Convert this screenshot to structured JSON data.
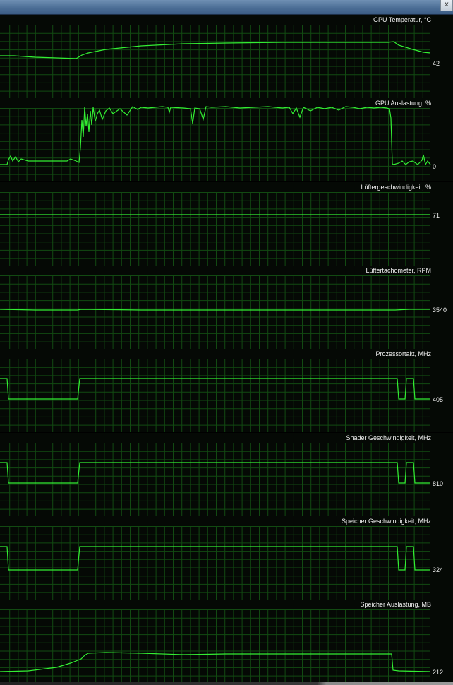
{
  "window": {
    "close_label": "x"
  },
  "colors": {
    "line": "#33ee33",
    "grid": "#124a12",
    "background": "#050905",
    "text": "#f0f0f0"
  },
  "panels": [
    {
      "title": "GPU Temperatur, °C",
      "value": "42",
      "points": [
        [
          0,
          58
        ],
        [
          20,
          58
        ],
        [
          50,
          60
        ],
        [
          80,
          61
        ],
        [
          108,
          62
        ],
        [
          116,
          57
        ],
        [
          125,
          54
        ],
        [
          150,
          49
        ],
        [
          200,
          44
        ],
        [
          260,
          41
        ],
        [
          320,
          40
        ],
        [
          400,
          39
        ],
        [
          480,
          39
        ],
        [
          550,
          39
        ],
        [
          558,
          38
        ],
        [
          565,
          43
        ],
        [
          585,
          49
        ],
        [
          600,
          53
        ],
        [
          610,
          54
        ]
      ]
    },
    {
      "title": "GPU Auslastung, %",
      "value": "0",
      "points": [
        [
          0,
          94
        ],
        [
          10,
          94
        ],
        [
          12,
          87
        ],
        [
          15,
          82
        ],
        [
          18,
          89
        ],
        [
          22,
          83
        ],
        [
          26,
          90
        ],
        [
          30,
          86
        ],
        [
          40,
          89
        ],
        [
          60,
          89
        ],
        [
          80,
          89
        ],
        [
          95,
          89
        ],
        [
          100,
          86
        ],
        [
          108,
          89
        ],
        [
          112,
          91
        ],
        [
          114,
          70
        ],
        [
          116,
          31
        ],
        [
          118,
          55
        ],
        [
          120,
          12
        ],
        [
          122,
          40
        ],
        [
          124,
          22
        ],
        [
          126,
          48
        ],
        [
          128,
          18
        ],
        [
          130,
          38
        ],
        [
          132,
          13
        ],
        [
          135,
          33
        ],
        [
          138,
          22
        ],
        [
          141,
          17
        ],
        [
          145,
          30
        ],
        [
          150,
          18
        ],
        [
          155,
          14
        ],
        [
          160,
          22
        ],
        [
          170,
          15
        ],
        [
          180,
          24
        ],
        [
          188,
          12
        ],
        [
          195,
          16
        ],
        [
          200,
          13
        ],
        [
          210,
          14
        ],
        [
          220,
          13
        ],
        [
          230,
          12
        ],
        [
          238,
          13
        ],
        [
          240,
          20
        ],
        [
          242,
          13
        ],
        [
          260,
          14
        ],
        [
          270,
          15
        ],
        [
          273,
          36
        ],
        [
          276,
          14
        ],
        [
          283,
          15
        ],
        [
          288,
          30
        ],
        [
          292,
          12
        ],
        [
          300,
          13
        ],
        [
          320,
          12
        ],
        [
          340,
          14
        ],
        [
          360,
          13
        ],
        [
          380,
          12
        ],
        [
          400,
          14
        ],
        [
          410,
          13
        ],
        [
          415,
          22
        ],
        [
          420,
          14
        ],
        [
          425,
          27
        ],
        [
          430,
          13
        ],
        [
          440,
          18
        ],
        [
          450,
          13
        ],
        [
          460,
          15
        ],
        [
          470,
          13
        ],
        [
          480,
          17
        ],
        [
          490,
          12
        ],
        [
          500,
          13
        ],
        [
          510,
          15
        ],
        [
          520,
          13
        ],
        [
          530,
          14
        ],
        [
          540,
          13
        ],
        [
          548,
          14
        ],
        [
          552,
          15
        ],
        [
          554,
          28
        ],
        [
          555,
          60
        ],
        [
          556,
          93
        ],
        [
          558,
          94
        ],
        [
          565,
          92
        ],
        [
          570,
          89
        ],
        [
          575,
          94
        ],
        [
          580,
          90
        ],
        [
          585,
          89
        ],
        [
          592,
          94
        ],
        [
          598,
          88
        ],
        [
          600,
          80
        ],
        [
          603,
          94
        ],
        [
          606,
          89
        ],
        [
          610,
          94
        ]
      ]
    },
    {
      "title": "Lüftergeschwindigkeit, %",
      "value": "71",
      "points": [
        [
          0,
          46
        ],
        [
          610,
          46
        ]
      ]
    },
    {
      "title": "Lüftertachometer, RPM",
      "value": "3540",
      "points": [
        [
          0,
          62
        ],
        [
          50,
          63
        ],
        [
          110,
          63
        ],
        [
          115,
          62
        ],
        [
          200,
          63
        ],
        [
          300,
          63
        ],
        [
          400,
          63
        ],
        [
          500,
          63
        ],
        [
          560,
          63
        ],
        [
          580,
          62
        ],
        [
          610,
          62
        ]
      ]
    },
    {
      "title": "Prozessortakt, MHz",
      "value": "405",
      "points": [
        [
          0,
          42
        ],
        [
          10,
          42
        ],
        [
          12,
          71
        ],
        [
          110,
          71
        ],
        [
          113,
          42
        ],
        [
          563,
          42
        ],
        [
          565,
          71
        ],
        [
          574,
          71
        ],
        [
          576,
          42
        ],
        [
          586,
          42
        ],
        [
          588,
          71
        ],
        [
          610,
          71
        ]
      ]
    },
    {
      "title": "Shader Geschwindigkeit, MHz",
      "value": "810",
      "points": [
        [
          0,
          42
        ],
        [
          10,
          42
        ],
        [
          12,
          71
        ],
        [
          110,
          71
        ],
        [
          113,
          42
        ],
        [
          563,
          42
        ],
        [
          565,
          71
        ],
        [
          574,
          71
        ],
        [
          576,
          42
        ],
        [
          586,
          42
        ],
        [
          588,
          71
        ],
        [
          610,
          71
        ]
      ]
    },
    {
      "title": "Speicher Geschwindigkeit, MHz",
      "value": "324",
      "points": [
        [
          0,
          43
        ],
        [
          10,
          43
        ],
        [
          12,
          76
        ],
        [
          110,
          76
        ],
        [
          113,
          43
        ],
        [
          563,
          43
        ],
        [
          565,
          76
        ],
        [
          574,
          76
        ],
        [
          576,
          43
        ],
        [
          586,
          43
        ],
        [
          588,
          76
        ],
        [
          610,
          76
        ]
      ]
    },
    {
      "title": "Speicher Auslastung, MB",
      "value": "212",
      "points": [
        [
          0,
          102
        ],
        [
          40,
          101
        ],
        [
          80,
          96
        ],
        [
          100,
          90
        ],
        [
          115,
          84
        ],
        [
          120,
          79
        ],
        [
          125,
          76
        ],
        [
          150,
          75
        ],
        [
          200,
          76
        ],
        [
          260,
          78
        ],
        [
          320,
          77
        ],
        [
          400,
          77
        ],
        [
          480,
          77
        ],
        [
          540,
          77
        ],
        [
          555,
          77
        ],
        [
          557,
          100
        ],
        [
          565,
          101
        ],
        [
          610,
          102
        ]
      ]
    }
  ]
}
